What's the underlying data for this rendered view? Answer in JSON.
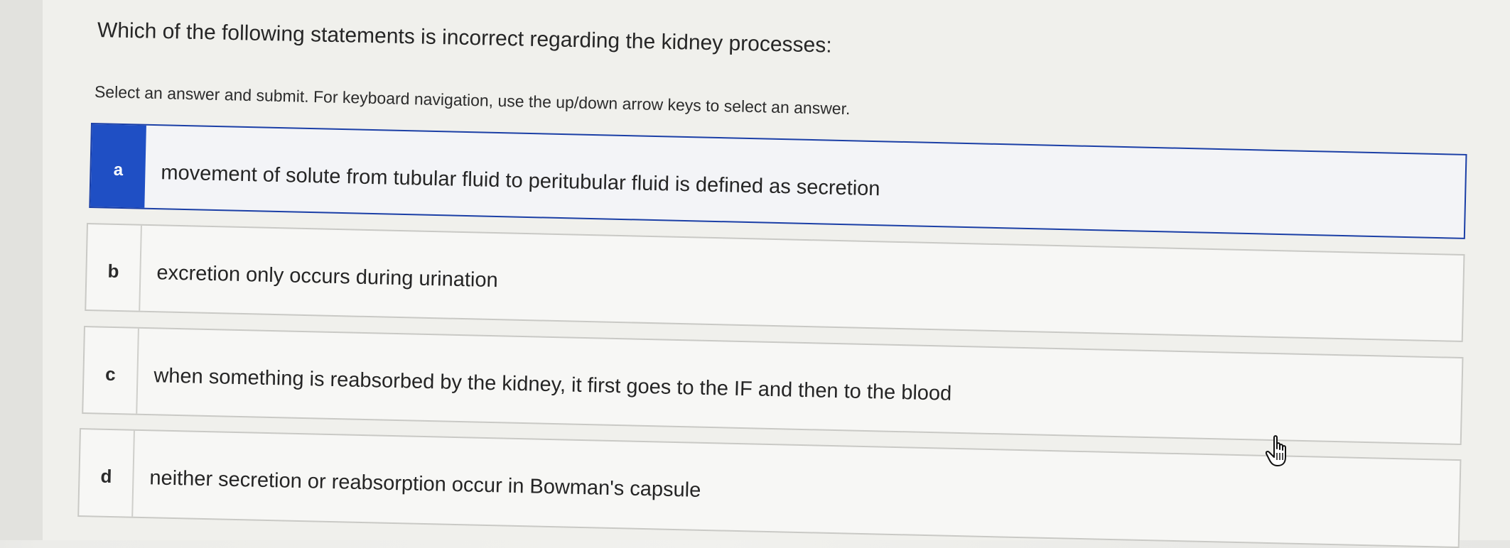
{
  "question": {
    "title": "Which of the following statements is incorrect regarding the kidney processes:",
    "instructions": "Select an answer and submit. For keyboard navigation, use the up/down arrow keys to select an answer."
  },
  "options": [
    {
      "letter": "a",
      "text": "movement of solute from tubular fluid to peritubular fluid is defined as secretion",
      "selected": true
    },
    {
      "letter": "b",
      "text": "excretion only occurs during urination",
      "selected": false
    },
    {
      "letter": "c",
      "text": "when something is reabsorbed by the kidney, it first goes to the IF and then to the blood",
      "selected": false
    },
    {
      "letter": "d",
      "text": "neither secretion or reabsorption occur in Bowman's capsule",
      "selected": false
    }
  ],
  "colors": {
    "selected_letter_bg": "#1f4fc4",
    "selected_border": "#1b3fa6",
    "option_border": "#c9c9c5",
    "background": "#f0f0ec"
  },
  "icons": {
    "cursor": "hand-pointer-icon"
  }
}
